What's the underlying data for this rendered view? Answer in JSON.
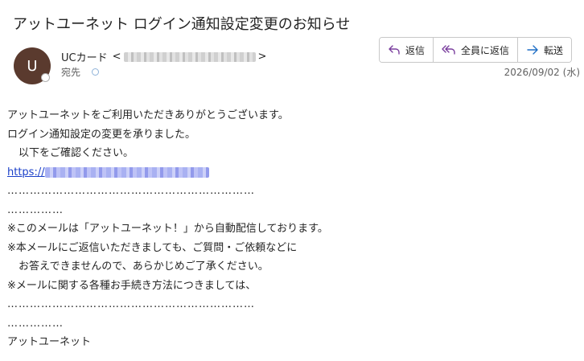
{
  "email": {
    "subject": "アットユーネット ログイン通知設定変更のお知らせ",
    "avatar_initial": "U",
    "sender_name": "UCカード",
    "sender_open": "<",
    "sender_close": ">",
    "to_label": "宛先",
    "date": "2026/09/02 (水)"
  },
  "actions": {
    "reply": "返信",
    "reply_all": "全員に返信",
    "forward": "転送"
  },
  "body": {
    "line1": "アットユーネットをご利用いただきありがとうございます。",
    "line2": "ログイン通知設定の変更を承りました。",
    "line3": "以下をご確認ください。",
    "link_prefix": "https://",
    "dots_long": "…………………………………………………………",
    "dots_short": "……………",
    "line4": "※このメールは「アットユーネット！」から自動配信しております。",
    "line5": "※本メールにご返信いただきましても、ご質問・ご依頼などに",
    "line6": "お答えできませんので、あらかじめご了承ください。",
    "line7": "※メールに関する各種お手続き方法につきましては、",
    "dots_long2": "…………………………………………………………",
    "dots_short2": "……………",
    "signature": "アットユーネット"
  },
  "colors": {
    "avatar": "#5a3a2e",
    "reply_icon": "#7a3e9d",
    "forward_icon": "#1f6fc5",
    "link": "#1a3fc9"
  },
  "icons": [
    "reply-icon",
    "reply-all-icon",
    "forward-icon"
  ]
}
